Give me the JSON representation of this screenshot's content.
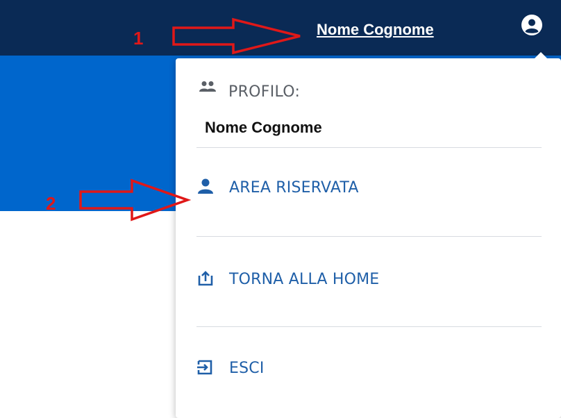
{
  "header": {
    "user_name": "Nome Cognome",
    "user_icon": "user-circle-icon",
    "background_color": "#0a2a55"
  },
  "banner": {
    "background_color": "#0066cc"
  },
  "dropdown": {
    "profile_label": "PROFILO:",
    "profile_icon": "group-icon",
    "profile_name": "Nome Cognome",
    "items": [
      {
        "label": "AREA RISERVATA",
        "icon": "person-icon"
      },
      {
        "label": "TORNA ALLA HOME",
        "icon": "upload-tray-icon"
      },
      {
        "label": "ESCI",
        "icon": "logout-arrow-icon"
      }
    ],
    "item_color": "#1f5fa8"
  },
  "annotations": {
    "marker_1": "1",
    "marker_2": "2",
    "color": "#e01818"
  }
}
